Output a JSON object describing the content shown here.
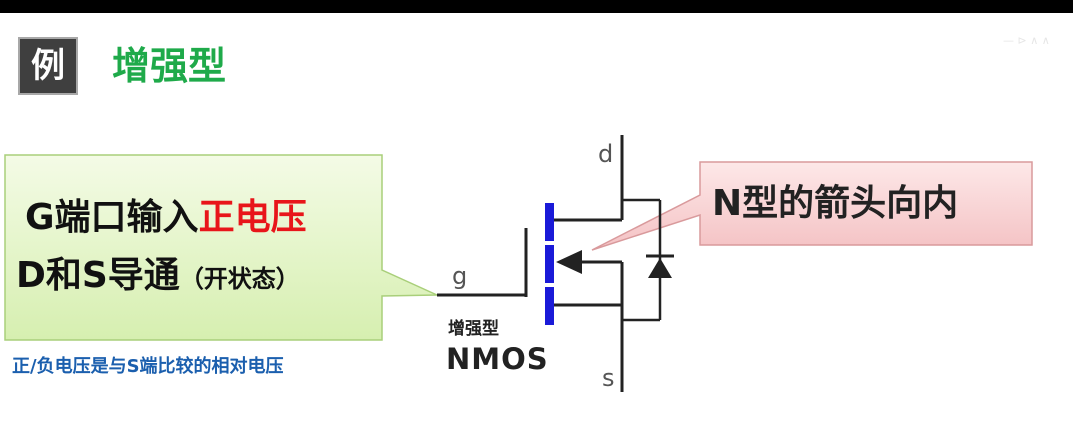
{
  "header": {
    "badge": "例",
    "title": "增强型"
  },
  "left_callout": {
    "line1_prefix": "G端口输入",
    "line1_highlight": "正电压",
    "line2_main": "D和S导通",
    "line2_paren": "（开状态）"
  },
  "note": "正/负电压是与S端比较的相对电压",
  "transistor": {
    "pin_d": "d",
    "pin_g": "g",
    "pin_s": "s",
    "sub_label": "增强型",
    "type_label": "NMOS"
  },
  "right_callout": {
    "text": "N型的箭头向内"
  },
  "watermark": "—  ⊳ ∧ ∧",
  "colors": {
    "accent_green": "#1faa4a",
    "highlight_red": "#e8151a",
    "note_blue": "#1b5fae",
    "channel_blue": "#1a1ad8",
    "left_callout_fill": "#e4f5c4",
    "right_callout_fill": "#f9d3d3"
  }
}
